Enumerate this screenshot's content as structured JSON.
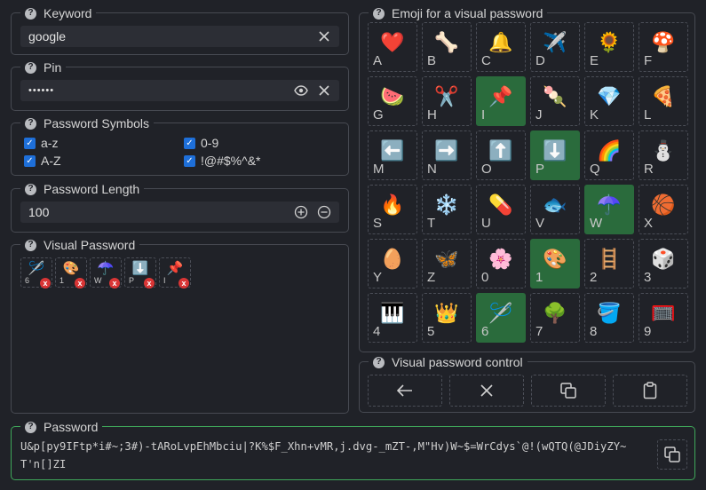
{
  "keyword": {
    "legend": "Keyword",
    "value": "google",
    "help": "?"
  },
  "pin": {
    "legend": "Pin",
    "value": "••••••",
    "help": "?"
  },
  "symbols": {
    "legend": "Password Symbols",
    "help": "?",
    "items": [
      {
        "label": "a-z",
        "checked": true
      },
      {
        "label": "0-9",
        "checked": true
      },
      {
        "label": "A-Z",
        "checked": true
      },
      {
        "label": "!@#$%^&*",
        "checked": true
      }
    ]
  },
  "length": {
    "legend": "Password Length",
    "value": "100",
    "help": "?"
  },
  "visual": {
    "legend": "Visual Password",
    "help": "?",
    "chips": [
      {
        "emoji": "🪡",
        "label": "6",
        "remove": "x"
      },
      {
        "emoji": "🎨",
        "label": "1",
        "remove": "x"
      },
      {
        "emoji": "☂️",
        "label": "W",
        "remove": "x"
      },
      {
        "emoji": "⬇️",
        "label": "P",
        "remove": "x"
      },
      {
        "emoji": "📌",
        "label": "I",
        "remove": "x"
      }
    ]
  },
  "emoji_panel": {
    "legend": "Emoji for a visual password",
    "help": "?",
    "cells": [
      {
        "emoji": "❤️",
        "label": "A",
        "selected": false
      },
      {
        "emoji": "🦴",
        "label": "B",
        "selected": false
      },
      {
        "emoji": "🔔",
        "label": "C",
        "selected": false
      },
      {
        "emoji": "✈️",
        "label": "D",
        "selected": false
      },
      {
        "emoji": "🌻",
        "label": "E",
        "selected": false
      },
      {
        "emoji": "🍄",
        "label": "F",
        "selected": false
      },
      {
        "emoji": "🍉",
        "label": "G",
        "selected": false
      },
      {
        "emoji": "✂️",
        "label": "H",
        "selected": false
      },
      {
        "emoji": "📌",
        "label": "I",
        "selected": true
      },
      {
        "emoji": "🍡",
        "label": "J",
        "selected": false
      },
      {
        "emoji": "💎",
        "label": "K",
        "selected": false
      },
      {
        "emoji": "🍕",
        "label": "L",
        "selected": false
      },
      {
        "emoji": "⬅️",
        "label": "M",
        "selected": false
      },
      {
        "emoji": "➡️",
        "label": "N",
        "selected": false
      },
      {
        "emoji": "⬆️",
        "label": "O",
        "selected": false
      },
      {
        "emoji": "⬇️",
        "label": "P",
        "selected": true
      },
      {
        "emoji": "🌈",
        "label": "Q",
        "selected": false
      },
      {
        "emoji": "⛄",
        "label": "R",
        "selected": false
      },
      {
        "emoji": "🔥",
        "label": "S",
        "selected": false
      },
      {
        "emoji": "❄️",
        "label": "T",
        "selected": false
      },
      {
        "emoji": "💊",
        "label": "U",
        "selected": false
      },
      {
        "emoji": "🐟",
        "label": "V",
        "selected": false
      },
      {
        "emoji": "☂️",
        "label": "W",
        "selected": true
      },
      {
        "emoji": "🏀",
        "label": "X",
        "selected": false
      },
      {
        "emoji": "🥚",
        "label": "Y",
        "selected": false
      },
      {
        "emoji": "🦋",
        "label": "Z",
        "selected": false
      },
      {
        "emoji": "🌸",
        "label": "0",
        "selected": false
      },
      {
        "emoji": "🎨",
        "label": "1",
        "selected": true
      },
      {
        "emoji": "🪜",
        "label": "2",
        "selected": false
      },
      {
        "emoji": "🎲",
        "label": "3",
        "selected": false
      },
      {
        "emoji": "🎹",
        "label": "4",
        "selected": false
      },
      {
        "emoji": "👑",
        "label": "5",
        "selected": false
      },
      {
        "emoji": "🪡",
        "label": "6",
        "selected": true
      },
      {
        "emoji": "🌳",
        "label": "7",
        "selected": false
      },
      {
        "emoji": "🪣",
        "label": "8",
        "selected": false
      },
      {
        "emoji": "🥅",
        "label": "9",
        "selected": false
      }
    ]
  },
  "control": {
    "legend": "Visual password control",
    "help": "?"
  },
  "password": {
    "legend": "Password",
    "help": "?",
    "value": "U&p[py9IFtp*i#~;3#)-tARoLvpEhMbciu|?K%$F_Xhn+vMR,j.dvg-_mZT-,M\"Hv)W~$=WrCdys`@!(wQTQ(@JDiyZY~T'n[]ZI"
  },
  "colors": {
    "accent_check": "#1e6fd9",
    "selected_cell": "#2a6b3c",
    "remove_badge": "#d93535",
    "password_border": "#3fa85a"
  }
}
